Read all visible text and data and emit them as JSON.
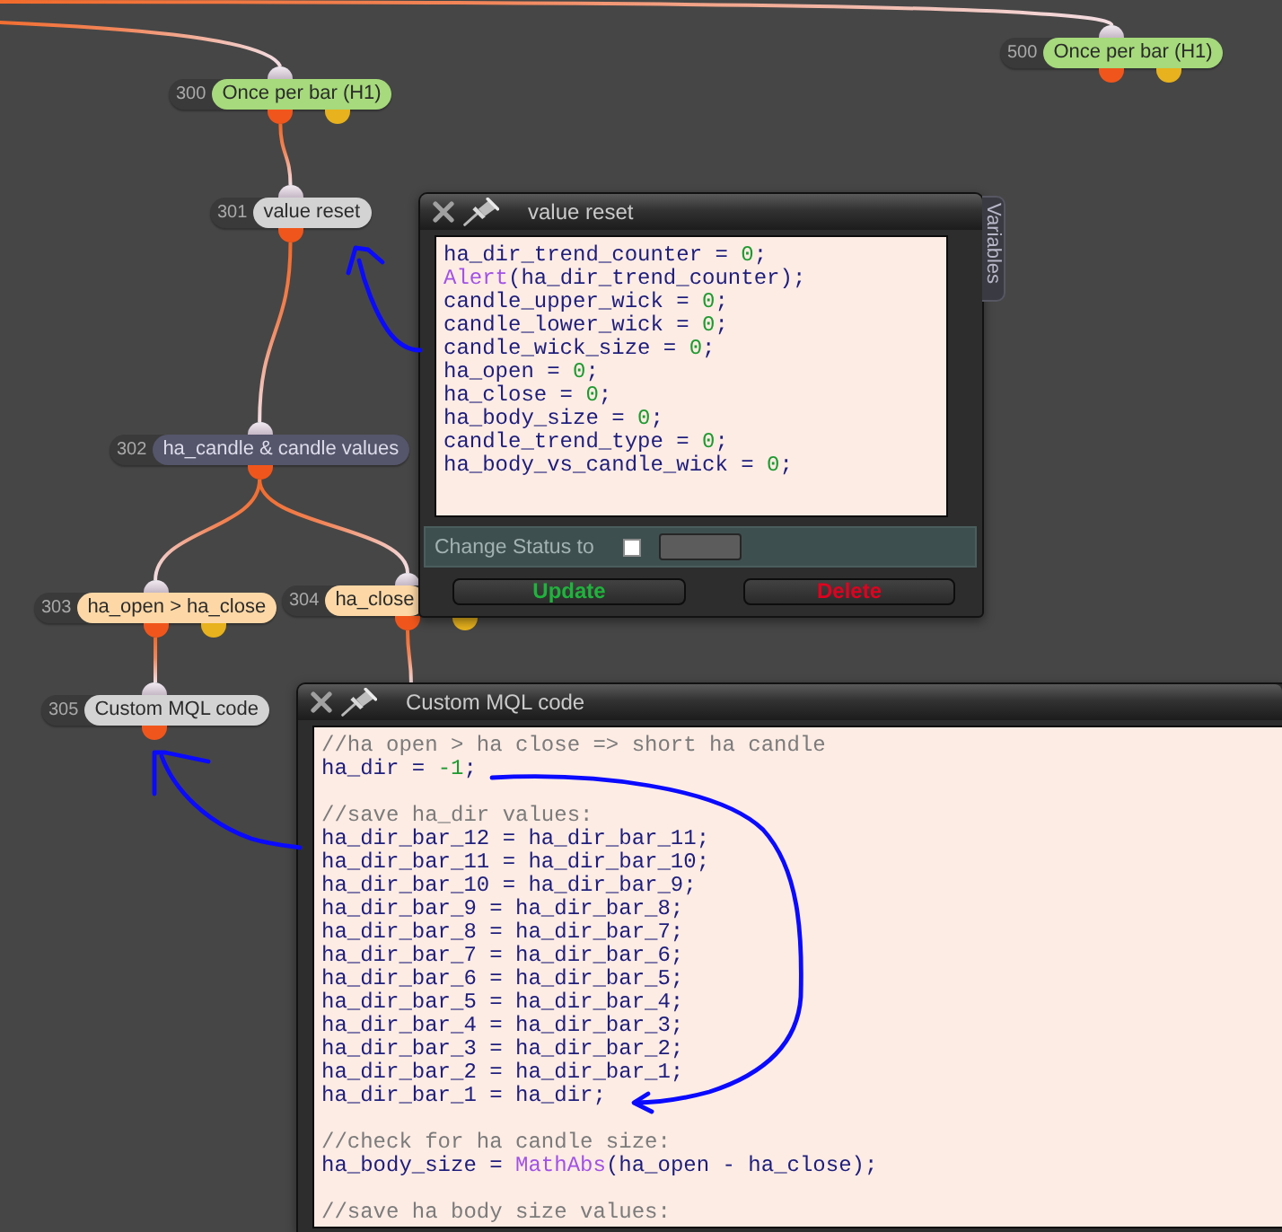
{
  "canvas": {
    "nodes": [
      {
        "number": "500",
        "label": "Once per bar (H1)",
        "kind": "condition",
        "color": "#a6da7c"
      },
      {
        "number": "300",
        "label": "Once per bar (H1)",
        "kind": "condition",
        "color": "#a6da7c"
      },
      {
        "number": "301",
        "label": "value reset",
        "kind": "action",
        "color": "#d3d3d3"
      },
      {
        "number": "302",
        "label": "ha_candle & candle values",
        "kind": "action",
        "color": "#55556b"
      },
      {
        "number": "303",
        "label": "ha_open > ha_close",
        "kind": "condition",
        "color": "#fdd8a6"
      },
      {
        "number": "304",
        "label": "ha_close",
        "kind": "condition",
        "color": "#fdd8a6"
      },
      {
        "number": "305",
        "label": "Custom MQL code",
        "kind": "action",
        "color": "#d3d3d3"
      }
    ]
  },
  "windows": [
    {
      "title": "value reset",
      "side_tab": "Variables",
      "code_lines": [
        {
          "kind": "code",
          "tokens": [
            {
              "kind": "plain",
              "text": "ha_dir_trend_counter = "
            },
            {
              "kind": "number",
              "text": "0"
            },
            {
              "kind": "plain",
              "text": ";"
            }
          ]
        },
        {
          "kind": "code",
          "tokens": [
            {
              "kind": "function",
              "text": "Alert"
            },
            {
              "kind": "plain",
              "text": "(ha_dir_trend_counter);"
            }
          ]
        },
        {
          "kind": "code",
          "tokens": [
            {
              "kind": "plain",
              "text": "candle_upper_wick = "
            },
            {
              "kind": "number",
              "text": "0"
            },
            {
              "kind": "plain",
              "text": ";"
            }
          ]
        },
        {
          "kind": "code",
          "tokens": [
            {
              "kind": "plain",
              "text": "candle_lower_wick = "
            },
            {
              "kind": "number",
              "text": "0"
            },
            {
              "kind": "plain",
              "text": ";"
            }
          ]
        },
        {
          "kind": "code",
          "tokens": [
            {
              "kind": "plain",
              "text": "candle_wick_size = "
            },
            {
              "kind": "number",
              "text": "0"
            },
            {
              "kind": "plain",
              "text": ";"
            }
          ]
        },
        {
          "kind": "code",
          "tokens": [
            {
              "kind": "plain",
              "text": "ha_open = "
            },
            {
              "kind": "number",
              "text": "0"
            },
            {
              "kind": "plain",
              "text": ";"
            }
          ]
        },
        {
          "kind": "code",
          "tokens": [
            {
              "kind": "plain",
              "text": "ha_close = "
            },
            {
              "kind": "number",
              "text": "0"
            },
            {
              "kind": "plain",
              "text": ";"
            }
          ]
        },
        {
          "kind": "code",
          "tokens": [
            {
              "kind": "plain",
              "text": "ha_body_size = "
            },
            {
              "kind": "number",
              "text": "0"
            },
            {
              "kind": "plain",
              "text": ";"
            }
          ]
        },
        {
          "kind": "code",
          "tokens": [
            {
              "kind": "plain",
              "text": "candle_trend_type = "
            },
            {
              "kind": "number",
              "text": "0"
            },
            {
              "kind": "plain",
              "text": ";"
            }
          ]
        },
        {
          "kind": "code",
          "tokens": [
            {
              "kind": "plain",
              "text": "ha_body_vs_candle_wick = "
            },
            {
              "kind": "number",
              "text": "0"
            },
            {
              "kind": "plain",
              "text": ";"
            }
          ]
        }
      ],
      "status_row": {
        "label": "Change Status to",
        "checked": false
      },
      "buttons": [
        {
          "label": "Update",
          "kind": "confirm"
        },
        {
          "label": "Delete",
          "kind": "danger"
        }
      ]
    },
    {
      "title": "Custom MQL code",
      "code_lines": [
        {
          "kind": "code",
          "tokens": [
            {
              "kind": "comment",
              "text": "//ha open > ha close => short ha candle"
            }
          ]
        },
        {
          "kind": "code",
          "tokens": [
            {
              "kind": "plain",
              "text": "ha_dir = "
            },
            {
              "kind": "number",
              "text": "-1"
            },
            {
              "kind": "plain",
              "text": ";"
            }
          ]
        },
        {
          "kind": "blank"
        },
        {
          "kind": "code",
          "tokens": [
            {
              "kind": "comment",
              "text": "//save ha_dir values:"
            }
          ]
        },
        {
          "kind": "code",
          "tokens": [
            {
              "kind": "plain",
              "text": "ha_dir_bar_12 = ha_dir_bar_11;"
            }
          ]
        },
        {
          "kind": "code",
          "tokens": [
            {
              "kind": "plain",
              "text": "ha_dir_bar_11 = ha_dir_bar_10;"
            }
          ]
        },
        {
          "kind": "code",
          "tokens": [
            {
              "kind": "plain",
              "text": "ha_dir_bar_10 = ha_dir_bar_9;"
            }
          ]
        },
        {
          "kind": "code",
          "tokens": [
            {
              "kind": "plain",
              "text": "ha_dir_bar_9 = ha_dir_bar_8;"
            }
          ]
        },
        {
          "kind": "code",
          "tokens": [
            {
              "kind": "plain",
              "text": "ha_dir_bar_8 = ha_dir_bar_7;"
            }
          ]
        },
        {
          "kind": "code",
          "tokens": [
            {
              "kind": "plain",
              "text": "ha_dir_bar_7 = ha_dir_bar_6;"
            }
          ]
        },
        {
          "kind": "code",
          "tokens": [
            {
              "kind": "plain",
              "text": "ha_dir_bar_6 = ha_dir_bar_5;"
            }
          ]
        },
        {
          "kind": "code",
          "tokens": [
            {
              "kind": "plain",
              "text": "ha_dir_bar_5 = ha_dir_bar_4;"
            }
          ]
        },
        {
          "kind": "code",
          "tokens": [
            {
              "kind": "plain",
              "text": "ha_dir_bar_4 = ha_dir_bar_3;"
            }
          ]
        },
        {
          "kind": "code",
          "tokens": [
            {
              "kind": "plain",
              "text": "ha_dir_bar_3 = ha_dir_bar_2;"
            }
          ]
        },
        {
          "kind": "code",
          "tokens": [
            {
              "kind": "plain",
              "text": "ha_dir_bar_2 = ha_dir_bar_1;"
            }
          ]
        },
        {
          "kind": "code",
          "tokens": [
            {
              "kind": "plain",
              "text": "ha_dir_bar_1 = ha_dir;"
            }
          ]
        },
        {
          "kind": "blank"
        },
        {
          "kind": "code",
          "tokens": [
            {
              "kind": "comment",
              "text": "//check for ha candle size:"
            }
          ]
        },
        {
          "kind": "code",
          "tokens": [
            {
              "kind": "plain",
              "text": "ha_body_size = "
            },
            {
              "kind": "function",
              "text": "MathAbs"
            },
            {
              "kind": "plain",
              "text": "(ha_open - ha_close);"
            }
          ]
        },
        {
          "kind": "blank"
        },
        {
          "kind": "code",
          "tokens": [
            {
              "kind": "comment",
              "text": "//save ha body size values:"
            }
          ]
        }
      ]
    }
  ]
}
